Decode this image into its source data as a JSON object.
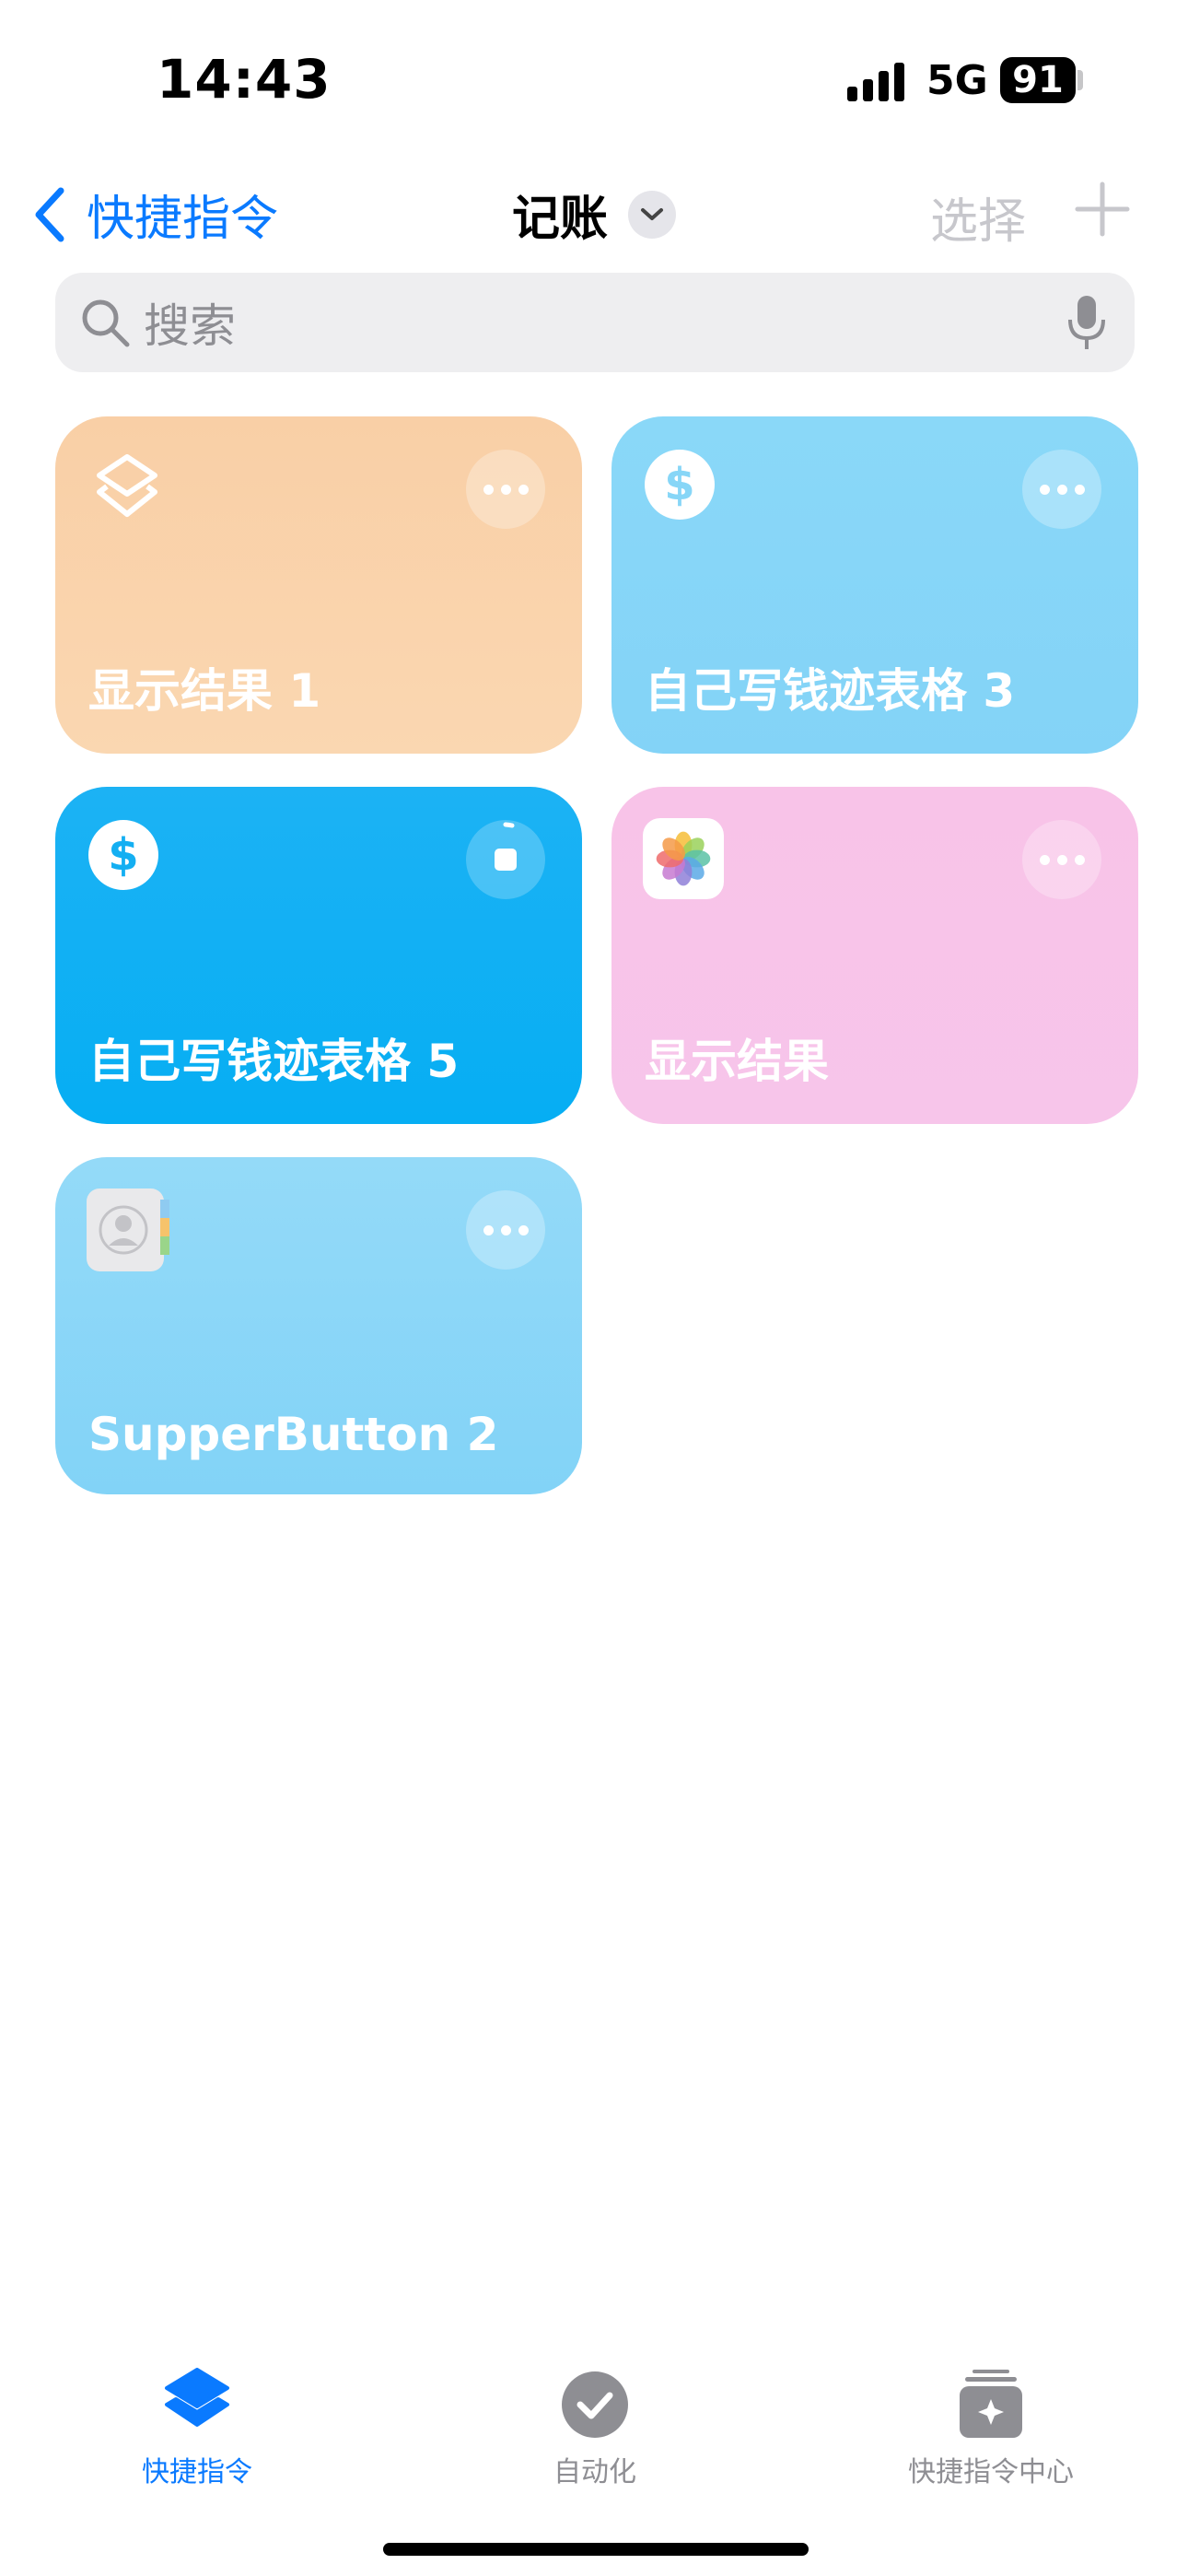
{
  "status_bar": {
    "time": "14:43",
    "network": "5G",
    "battery": "91"
  },
  "nav": {
    "back_label": "快捷指令",
    "title": "记账",
    "select_label": "选择"
  },
  "search": {
    "placeholder": "搜索"
  },
  "cards": [
    {
      "label": "显示结果 1",
      "icon": "shortcuts-layers-icon",
      "color": "#f9cfa6"
    },
    {
      "label": "自己写钱迹表格 3",
      "icon": "dollar-icon",
      "color": "#87d6f7"
    },
    {
      "label": "自己写钱迹表格 5",
      "icon": "dollar-icon",
      "color": "#14aff2"
    },
    {
      "label": "显示结果",
      "icon": "photos-icon",
      "color": "#f8c3e8"
    },
    {
      "label": "SupperButton 2",
      "icon": "contacts-icon",
      "color": "#8dd7f8"
    }
  ],
  "tabs": [
    {
      "label": "快捷指令",
      "active": true,
      "icon": "shortcuts-icon"
    },
    {
      "label": "自动化",
      "active": false,
      "icon": "automation-check-icon"
    },
    {
      "label": "快捷指令中心",
      "active": false,
      "icon": "gallery-icon"
    }
  ],
  "colors": {
    "accent": "#0a7aff",
    "inactive": "#8e8e93"
  }
}
